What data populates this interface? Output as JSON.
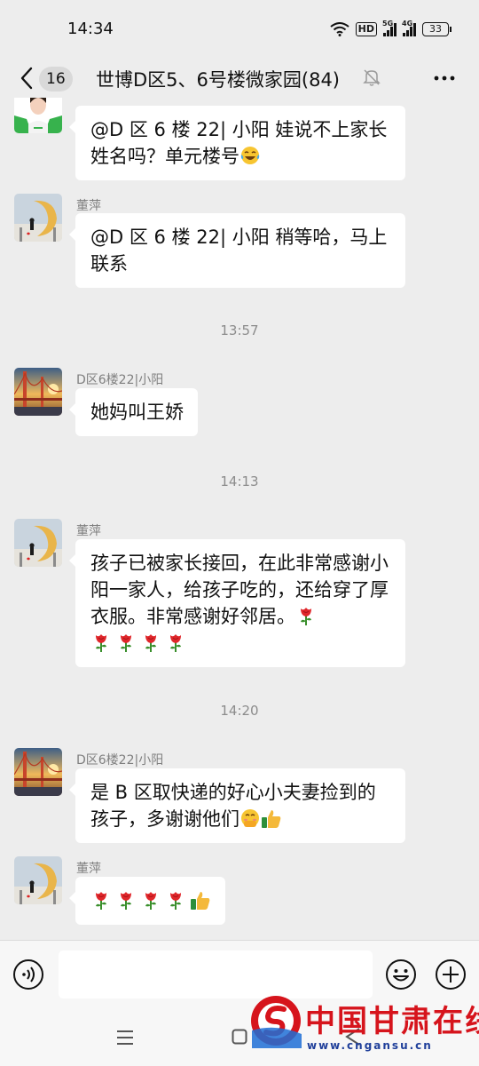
{
  "status_bar": {
    "time": "14:34",
    "hd_badge": "HD",
    "sig1_tag": "5G",
    "sig2_tag": "4G",
    "battery": "33",
    "icons": [
      "wifi-icon",
      "hd-icon",
      "signal-5g-icon",
      "signal-4g-icon",
      "battery-icon"
    ]
  },
  "header": {
    "unread_count": "16",
    "title": "世博D区5、6号楼微家园(84)",
    "icons": [
      "back-chevron-icon",
      "mute-bell-icon",
      "more-dots-icon"
    ]
  },
  "messages": [
    {
      "type": "message",
      "sender": "",
      "text": "@D 区 6 楼 22| 小阳  娃说不上家长姓名吗？单元楼号",
      "emoji": "crying-laughing-emoji"
    },
    {
      "type": "message",
      "sender": "董萍",
      "text": "@D 区 6 楼 22| 小阳  稍等哈，马上联系"
    },
    {
      "type": "time",
      "text": "13:57"
    },
    {
      "type": "message",
      "sender": "D区6楼22|小阳",
      "text": "她妈叫王娇"
    },
    {
      "type": "time",
      "text": "14:13"
    },
    {
      "type": "message",
      "sender": "董萍",
      "text": "孩子已被家长接回，在此非常感谢小阳一家人，给孩子吃的，还给穿了厚衣服。非常感谢好邻居。",
      "emoji": "rose-emoji x5"
    },
    {
      "type": "time",
      "text": "14:20"
    },
    {
      "type": "message",
      "sender": "D区6楼22|小阳",
      "text": "是 B 区取快递的好心小夫妻捡到的孩子，多谢谢他们",
      "emoji": "shy-emoji, thumbs-up-emoji"
    },
    {
      "type": "message",
      "sender": "董萍",
      "text": "",
      "emoji": "rose-emoji x4, thumbs-up-emoji"
    }
  ],
  "input_bar": {
    "placeholder": "",
    "icons": [
      "voice-icon",
      "emoji-icon",
      "plus-icon"
    ]
  },
  "nav_bar": {
    "icons": [
      "menu-icon",
      "home-icon",
      "back-icon"
    ]
  },
  "watermark": {
    "name": "中国甘肃在线",
    "url": "www.cngansu.cn"
  },
  "colors": {
    "background": "#ededed",
    "bubble": "#ffffff",
    "meta_text": "#8c8c8c",
    "watermark_red": "#d6141c",
    "watermark_blue": "#1f3f9a"
  }
}
